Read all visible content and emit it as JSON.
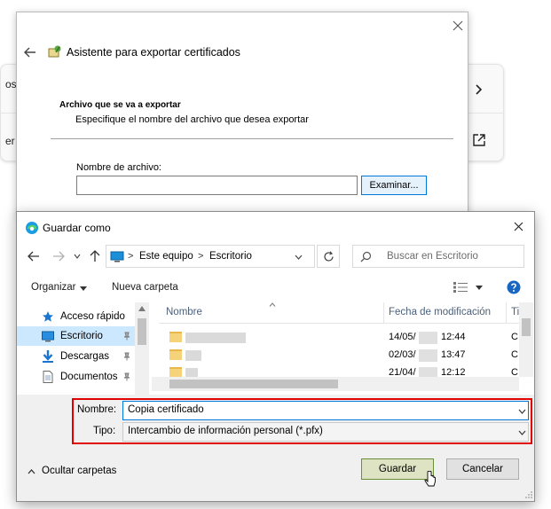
{
  "background": {
    "text_partial_1": "os",
    "text_partial_2": "er"
  },
  "wizard": {
    "title": "Asistente para exportar certificados",
    "heading": "Archivo que se va a exportar",
    "description": "Especifique el nombre del archivo que desea exportar",
    "filename_label": "Nombre de archivo:",
    "filename_value": "",
    "browse_label": "Examinar..."
  },
  "dialog": {
    "title": "Guardar como",
    "address": {
      "segments": [
        "Este equipo",
        "Escritorio"
      ]
    },
    "search_placeholder": "Buscar en Escritorio",
    "toolbar": {
      "organize_label": "Organizar",
      "new_folder_label": "Nueva carpeta"
    },
    "nav_items": [
      {
        "label": "Acceso rápido",
        "icon": "star-icon"
      },
      {
        "label": "Escritorio",
        "icon": "desktop-icon"
      },
      {
        "label": "Descargas",
        "icon": "download-icon"
      },
      {
        "label": "Documentos",
        "icon": "document-icon"
      }
    ],
    "columns": {
      "name": "Nombre",
      "date": "Fecha de modificación",
      "type": "Ti"
    },
    "files": [
      {
        "date": "14/05/",
        "time": "12:44",
        "type": "C"
      },
      {
        "date": "02/03/",
        "time": "13:47",
        "type": "C"
      },
      {
        "date": "21/04/",
        "time": "12:12",
        "type": "C"
      }
    ],
    "name_label": "Nombre:",
    "name_value": "Copia certificado",
    "type_label": "Tipo:",
    "type_value": "Intercambio de información personal (*.pfx)",
    "hide_folders_label": "Ocultar carpetas",
    "save_label": "Guardar",
    "cancel_label": "Cancelar"
  },
  "colors": {
    "highlight_box": "#e00000",
    "selected_nav": "#cce8ff",
    "save_button": "#dde3c3"
  }
}
